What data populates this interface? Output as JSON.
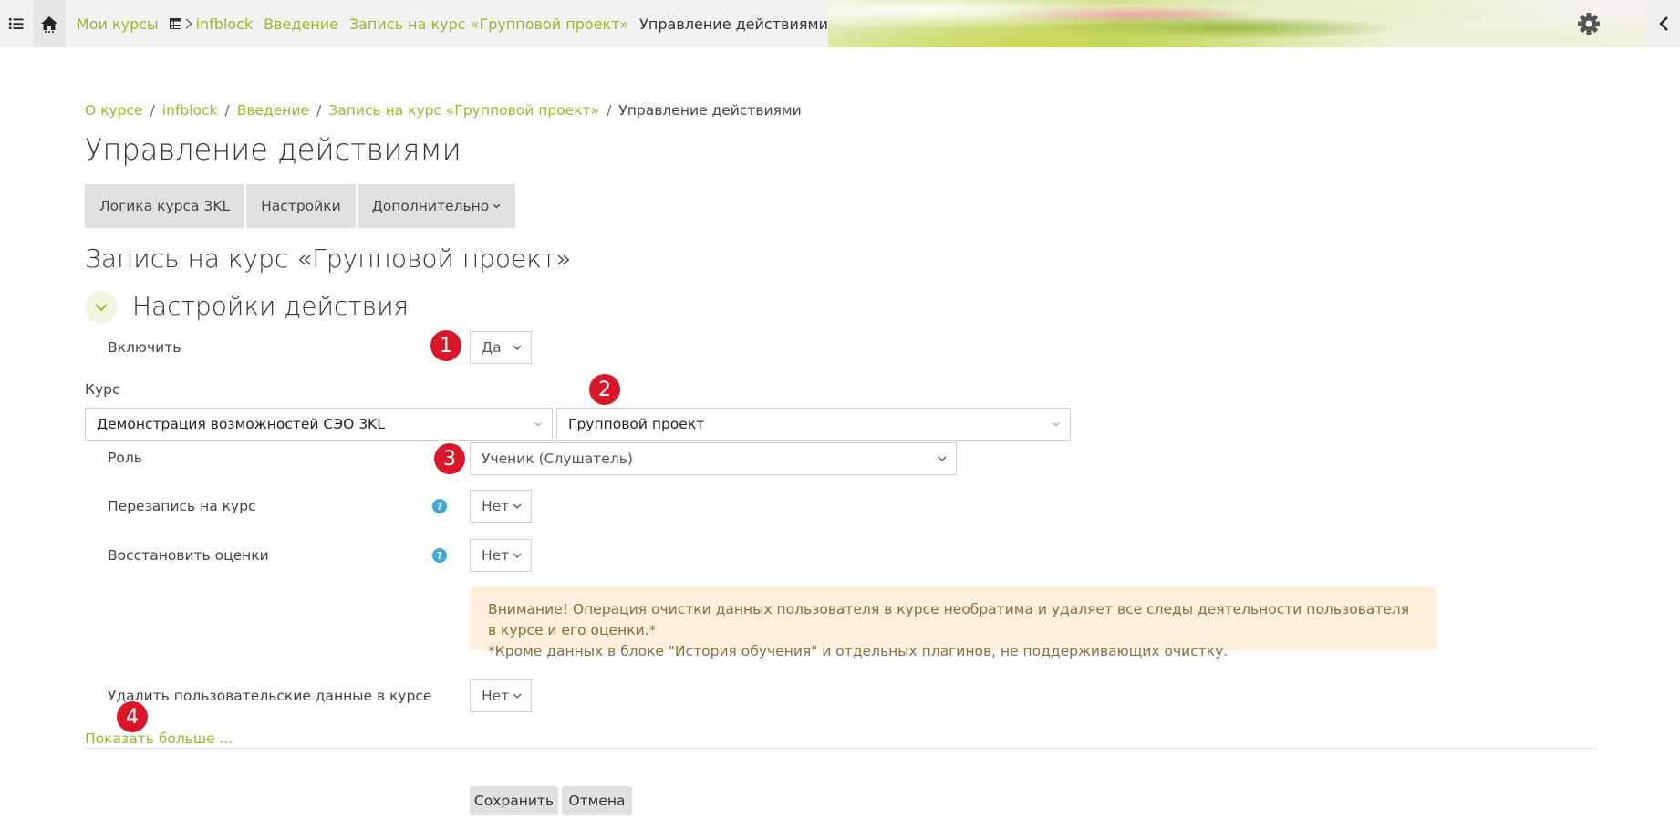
{
  "navbar": {
    "breadcrumbs": [
      "Мои курсы",
      "infblock",
      "Введение",
      "Запись на курс «Групповой проект»",
      "Управление действиями"
    ]
  },
  "page": {
    "breadcrumbs": [
      "О курсе",
      "infblock",
      "Введение",
      "Запись на курс «Групповой проект»",
      "Управление действиями"
    ],
    "separator": "/",
    "title": "Управление действиями",
    "tabs": [
      "Логика курса 3KL",
      "Настройки",
      "Дополнительно"
    ],
    "section_title": "Запись на курс «Групповой проект»",
    "fieldset_title": "Настройки действия"
  },
  "form": {
    "enable": {
      "label": "Включить",
      "value": "Да"
    },
    "course": {
      "label": "Курс",
      "value": "Демонстрация возможностей СЭО 3KL",
      "module_value": "Групповой проект"
    },
    "role": {
      "label": "Роль",
      "value": "Ученик (Слушатель)"
    },
    "reenroll": {
      "label": "Перезапись на курс",
      "value": "Нет"
    },
    "restore_grades": {
      "label": "Восстановить оценки",
      "value": "Нет"
    },
    "warning": {
      "line1": "Внимание! Операция очистки данных пользователя в курсе необратима и удаляет все следы деятельности пользователя в курсе и его оценки.*",
      "line2": "*Кроме данных в блоке \"История обучения\" и отдельных плагинов, не поддерживающих очистку."
    },
    "delete_userdata": {
      "label": "Удалить пользовательские данные в курсе",
      "value": "Нет"
    },
    "show_more": "Показать больше ...",
    "save": "Сохранить",
    "cancel": "Отмена"
  },
  "annotations": [
    "1",
    "2",
    "3",
    "4"
  ],
  "help_symbol": "?",
  "colors": {
    "accent": "#9db62a",
    "badge": "#d9172a",
    "help": "#3fa9d1",
    "alert_bg": "#fcefdc",
    "alert_text": "#8a6d3b"
  }
}
